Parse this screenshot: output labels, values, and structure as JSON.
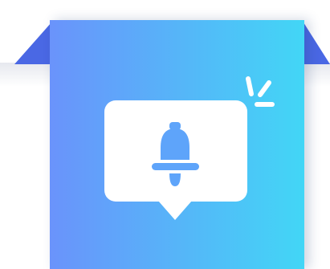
{
  "illustration": {
    "icon": "bell-icon",
    "badge_icon": "sparkle-icon",
    "colors": {
      "gradient_start": "#6a93fb",
      "gradient_end": "#42d6f6",
      "fold": "#4a68e4",
      "bubble": "#ffffff",
      "bell": "#5ea4fa"
    }
  }
}
